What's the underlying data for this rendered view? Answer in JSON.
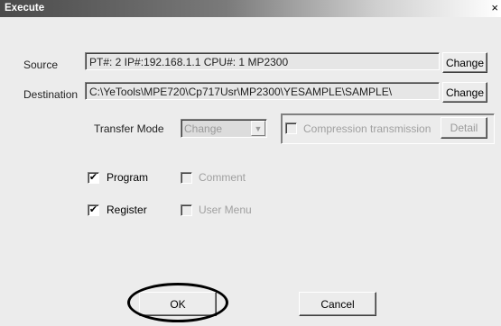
{
  "window": {
    "title": "Execute",
    "close_glyph": "×"
  },
  "source": {
    "label": "Source",
    "value": "PT#: 2 IP#:192.168.1.1 CPU#: 1    MP2300",
    "button": "Change"
  },
  "destination": {
    "label": "Destination",
    "value": "C:\\YeTools\\MPE720\\Cp717Usr\\MP2300\\YESAMPLE\\SAMPLE\\",
    "button": "Change"
  },
  "transfer_mode": {
    "label": "Transfer Mode",
    "selected": "Change"
  },
  "compression": {
    "label": "Compression transmission",
    "checked": false,
    "detail_button": "Detail"
  },
  "options": {
    "program": {
      "label": "Program",
      "checked": true,
      "mark": "✔"
    },
    "comment": {
      "label": "Comment",
      "checked": false
    },
    "register": {
      "label": "Register",
      "checked": true,
      "mark": "✔"
    },
    "user_menu": {
      "label": "User Menu",
      "checked": false
    }
  },
  "footer": {
    "ok": "OK",
    "cancel": "Cancel"
  },
  "colors": {
    "highlight_circle": "#000000",
    "dialog_bg": "#ececec"
  },
  "icons": {
    "close": "close-icon",
    "dropdown": "chevron-down-icon",
    "check": "checkmark-icon"
  }
}
